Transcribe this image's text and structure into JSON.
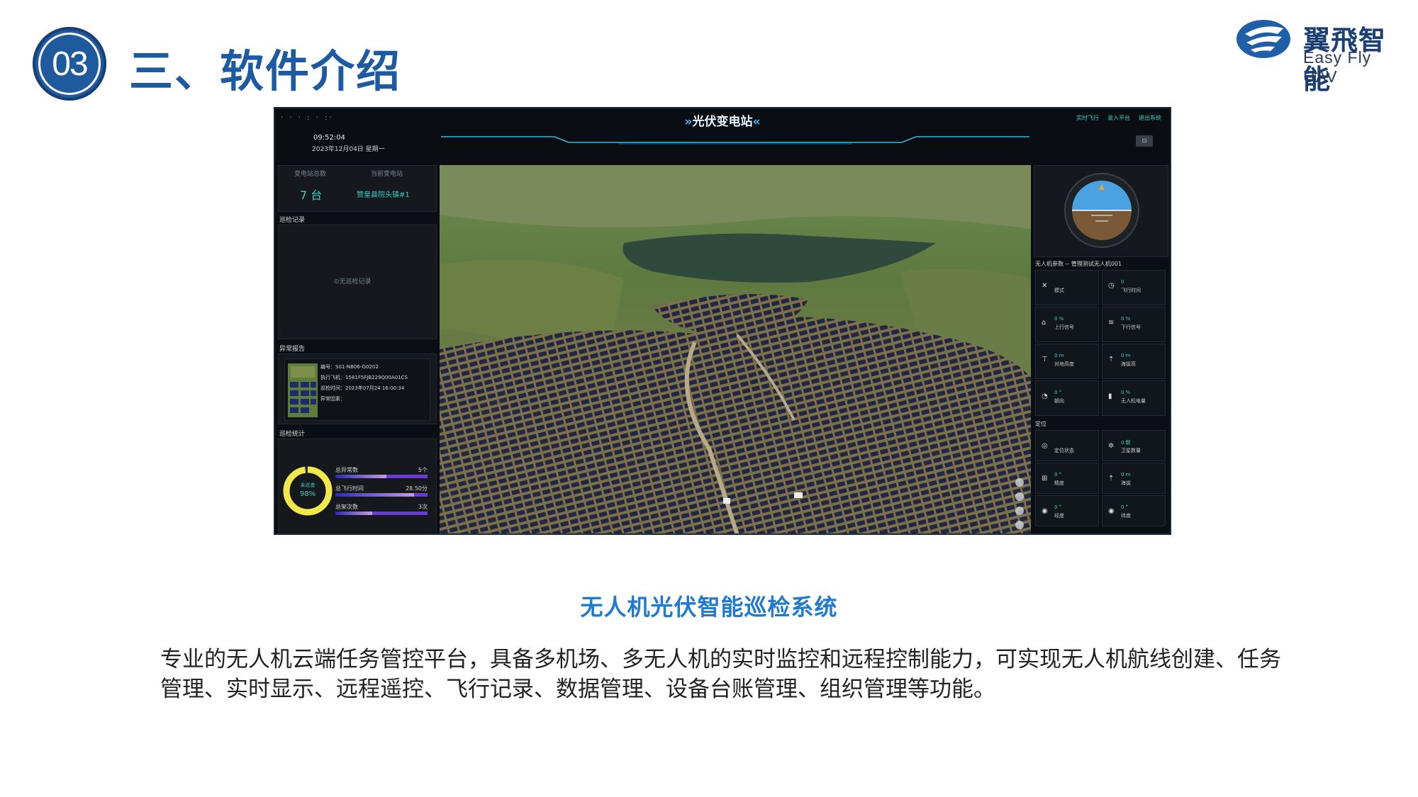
{
  "header": {
    "badge_number": "03",
    "title": "三、软件介绍"
  },
  "logo": {
    "name_cn": "翼飛智能",
    "name_en": "Easy Fly UAV",
    "brand_color": "#1c5aa4"
  },
  "dashboard": {
    "title": "光伏变电站",
    "title_arrows_left": "»",
    "title_arrows_right": "«",
    "time": "09:52:04",
    "date": "2023年12月04日  星期一",
    "nav": [
      "实时飞行",
      "录入平台",
      "退出系统"
    ],
    "stations": {
      "total_label": "变电站总数",
      "current_label": "当前变电站",
      "total_value": "7 台",
      "current_value": "赞皇县院头镇#1"
    },
    "patrol_records": {
      "heading": "巡检记录",
      "empty_text": "⊙无巡检记录"
    },
    "anomaly": {
      "heading": "异常报告",
      "lines": [
        "编号：S01-NB06-G0202",
        "执行飞机：1581F5FJB229Q00A01CS",
        "巡检时间：2023年07月24 16:00:34",
        "异常因素："
      ]
    },
    "stats": {
      "heading": "巡检统计",
      "donut_label": "未巡查",
      "donut_value": "98%",
      "donut_fraction": 0.98,
      "rows": [
        {
          "label": "总异常数",
          "value": "5个",
          "fraction": 0.55
        },
        {
          "label": "总飞行时间",
          "value": "28.50分",
          "fraction": 0.85
        },
        {
          "label": "总架次数",
          "value": "3次",
          "fraction": 0.4
        }
      ]
    },
    "drone_params": {
      "heading": "无人机参数 -- 管理测试无人机001",
      "cells": [
        {
          "icon": "✕",
          "val": "",
          "name": "模式"
        },
        {
          "icon": "◷",
          "val": "0",
          "name": "飞行时间"
        },
        {
          "icon": "⌂",
          "val": "0 %",
          "name": "上行信号"
        },
        {
          "icon": "≋",
          "val": "0 %",
          "name": "下行信号"
        },
        {
          "icon": "⊤",
          "val": "0 m",
          "name": "对地高度"
        },
        {
          "icon": "⇡",
          "val": "0 m",
          "name": "海拔高"
        },
        {
          "icon": "◔",
          "val": "0 °",
          "name": "朝向"
        },
        {
          "icon": "▮",
          "val": "0 %",
          "name": "无人机电量"
        }
      ]
    },
    "positioning": {
      "heading": "定位",
      "cells": [
        {
          "icon": "◎",
          "val": "",
          "name": "定位状态"
        },
        {
          "icon": "✲",
          "val": "0 颗",
          "name": "卫星数量"
        },
        {
          "icon": "⊞",
          "val": "0 °",
          "name": "精度"
        },
        {
          "icon": "⇡",
          "val": "0 m",
          "name": "海拔"
        },
        {
          "icon": "◉",
          "val": "0 °",
          "name": "经度"
        },
        {
          "icon": "◉",
          "val": "0 °",
          "name": "纬度"
        }
      ]
    }
  },
  "caption": "无人机光伏智能巡检系统",
  "description": "专业的无人机云端任务管控平台，具备多机场、多无人机的实时监控和远程控制能力，可实现无人机航线创建、任务管理、实时显示、远程遥控、飞行记录、数据管理、设备台账管理、组织管理等功能。"
}
